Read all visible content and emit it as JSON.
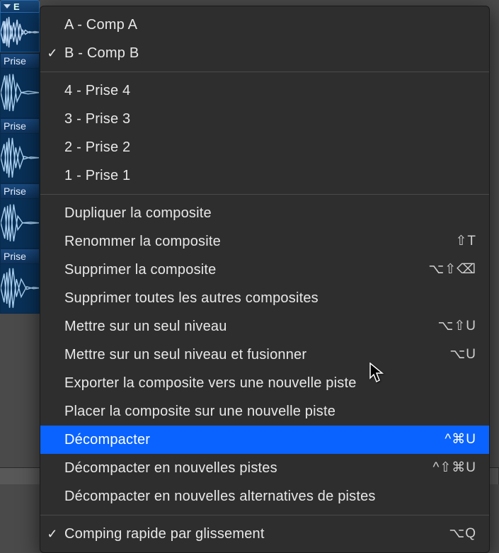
{
  "track_header": "E",
  "regions": [
    {
      "label": "Prise"
    },
    {
      "label": "Prise"
    },
    {
      "label": "Prise"
    },
    {
      "label": "Prise"
    }
  ],
  "menu": {
    "section1": [
      {
        "label": "A - Comp A",
        "checked": false
      },
      {
        "label": "B - Comp B",
        "checked": true
      }
    ],
    "section2": [
      {
        "label": "4 - Prise 4"
      },
      {
        "label": "3 - Prise 3"
      },
      {
        "label": "2 - Prise 2"
      },
      {
        "label": "1 - Prise 1"
      }
    ],
    "section3": [
      {
        "label": "Dupliquer la composite",
        "shortcut": ""
      },
      {
        "label": "Renommer la composite",
        "shortcut": "⇧T"
      },
      {
        "label": "Supprimer la composite",
        "shortcut": "⌥⇧⌫"
      },
      {
        "label": "Supprimer toutes les autres composites",
        "shortcut": ""
      },
      {
        "label": "Mettre sur un seul niveau",
        "shortcut": "⌥⇧U"
      },
      {
        "label": "Mettre sur un seul niveau et fusionner",
        "shortcut": "⌥U"
      },
      {
        "label": "Exporter la composite vers une nouvelle piste",
        "shortcut": ""
      },
      {
        "label": "Placer la composite sur une nouvelle piste",
        "shortcut": ""
      },
      {
        "label": "Décompacter",
        "shortcut": "^⌘U",
        "highlighted": true
      },
      {
        "label": "Décompacter en nouvelles pistes",
        "shortcut": "^⇧⌘U"
      },
      {
        "label": "Décompacter en nouvelles alternatives de pistes",
        "shortcut": ""
      }
    ],
    "section4": [
      {
        "label": "Comping rapide par glissement",
        "checked": true,
        "shortcut": "⌥Q"
      }
    ]
  }
}
